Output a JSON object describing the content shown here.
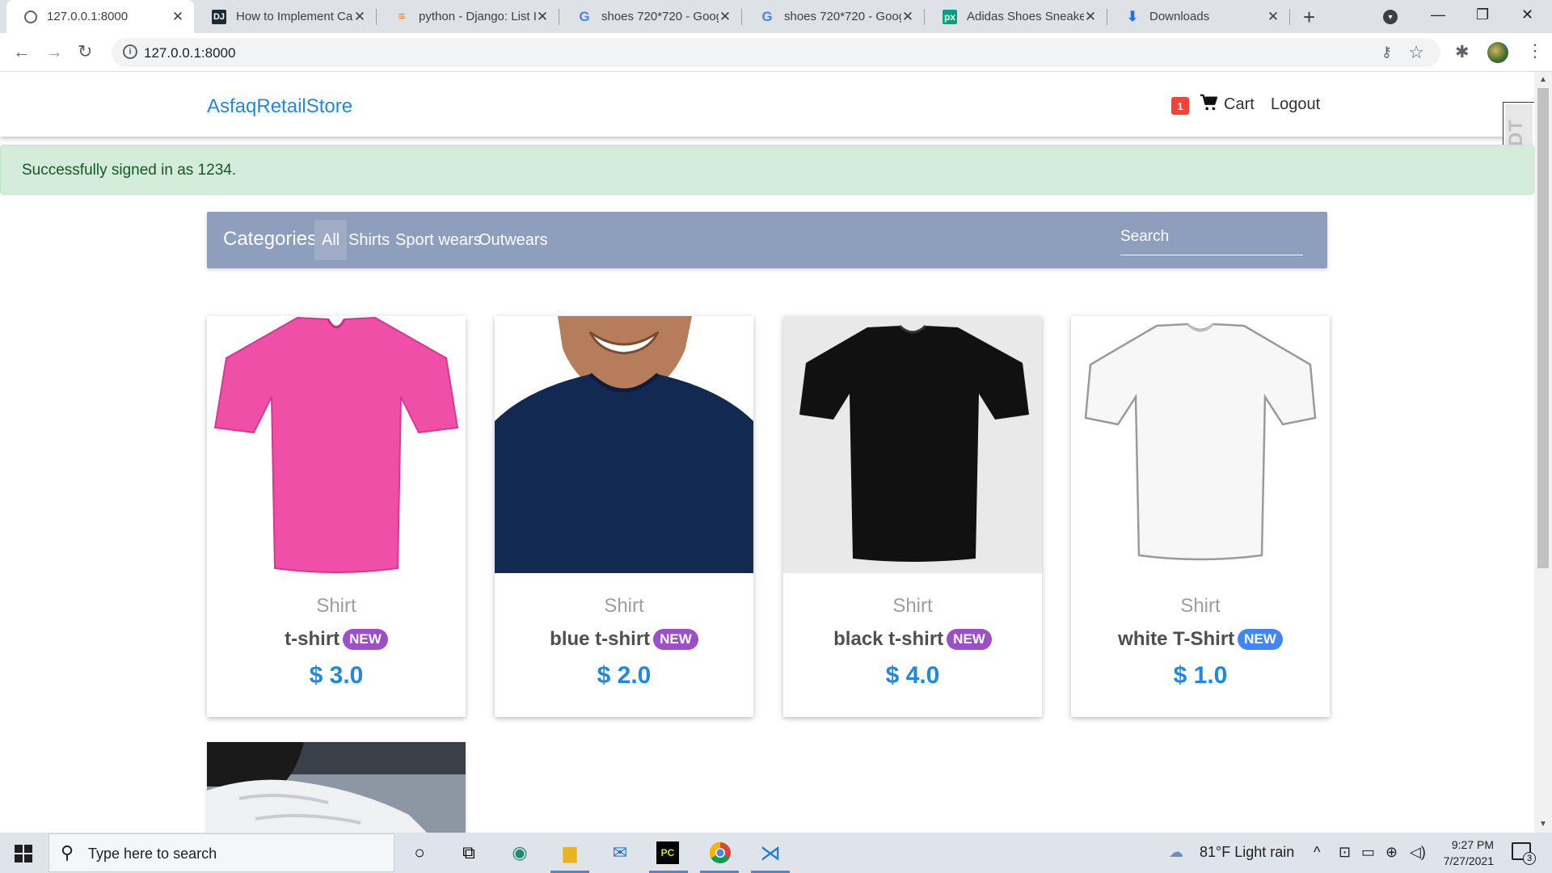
{
  "browser": {
    "tabs": [
      {
        "title": "127.0.0.1:8000",
        "active": true
      },
      {
        "title": "How to Implement Ca",
        "active": false
      },
      {
        "title": "python - Django: List I",
        "active": false
      },
      {
        "title": "shoes 720*720 - Goog",
        "active": false
      },
      {
        "title": "shoes 720*720 - Goog",
        "active": false
      },
      {
        "title": "Adidas Shoes Sneaker",
        "active": false
      },
      {
        "title": "Downloads",
        "active": false
      }
    ],
    "new_tab": "+",
    "url": "127.0.0.1:8000"
  },
  "page": {
    "brand": "AsfaqRetailStore",
    "cart_count": "1",
    "cart_label": "Cart",
    "logout_label": "Logout",
    "alert": "Successfully signed in as 1234.",
    "debug_toolbar": "DjDT",
    "categories": {
      "title": "Categories:",
      "items": [
        "All",
        "Shirts",
        "Sport wears",
        "Outwears"
      ],
      "active": "All",
      "search_placeholder": "Search"
    },
    "products": [
      {
        "category": "Shirt",
        "name": "t-shirt",
        "badge": "NEW",
        "badge_color": "#9c4fc9",
        "price": "$ 3.0",
        "shirt_color": "#f04fa8"
      },
      {
        "category": "Shirt",
        "name": "blue t-shirt",
        "badge": "NEW",
        "badge_color": "#9c4fc9",
        "price": "$ 2.0",
        "shirt_color": "#122a52"
      },
      {
        "category": "Shirt",
        "name": "black t-shirt",
        "badge": "NEW",
        "badge_color": "#9c4fc9",
        "price": "$ 4.0",
        "shirt_color": "#111111"
      },
      {
        "category": "Shirt",
        "name": "white T-Shirt",
        "badge": "NEW",
        "badge_color": "#4285f4",
        "price": "$ 1.0",
        "shirt_color": "#f7f7f7"
      }
    ]
  },
  "taskbar": {
    "search_placeholder": "Type here to search",
    "weather": "81°F  Light rain",
    "time": "9:27 PM",
    "date": "7/27/2021",
    "notifications": "3"
  },
  "colors": {
    "brand": "#1e88e5",
    "category_bar": "#8e9ebd",
    "alert_bg": "#d4edda",
    "alert_text": "#155724",
    "cart_badge": "#f44336"
  }
}
